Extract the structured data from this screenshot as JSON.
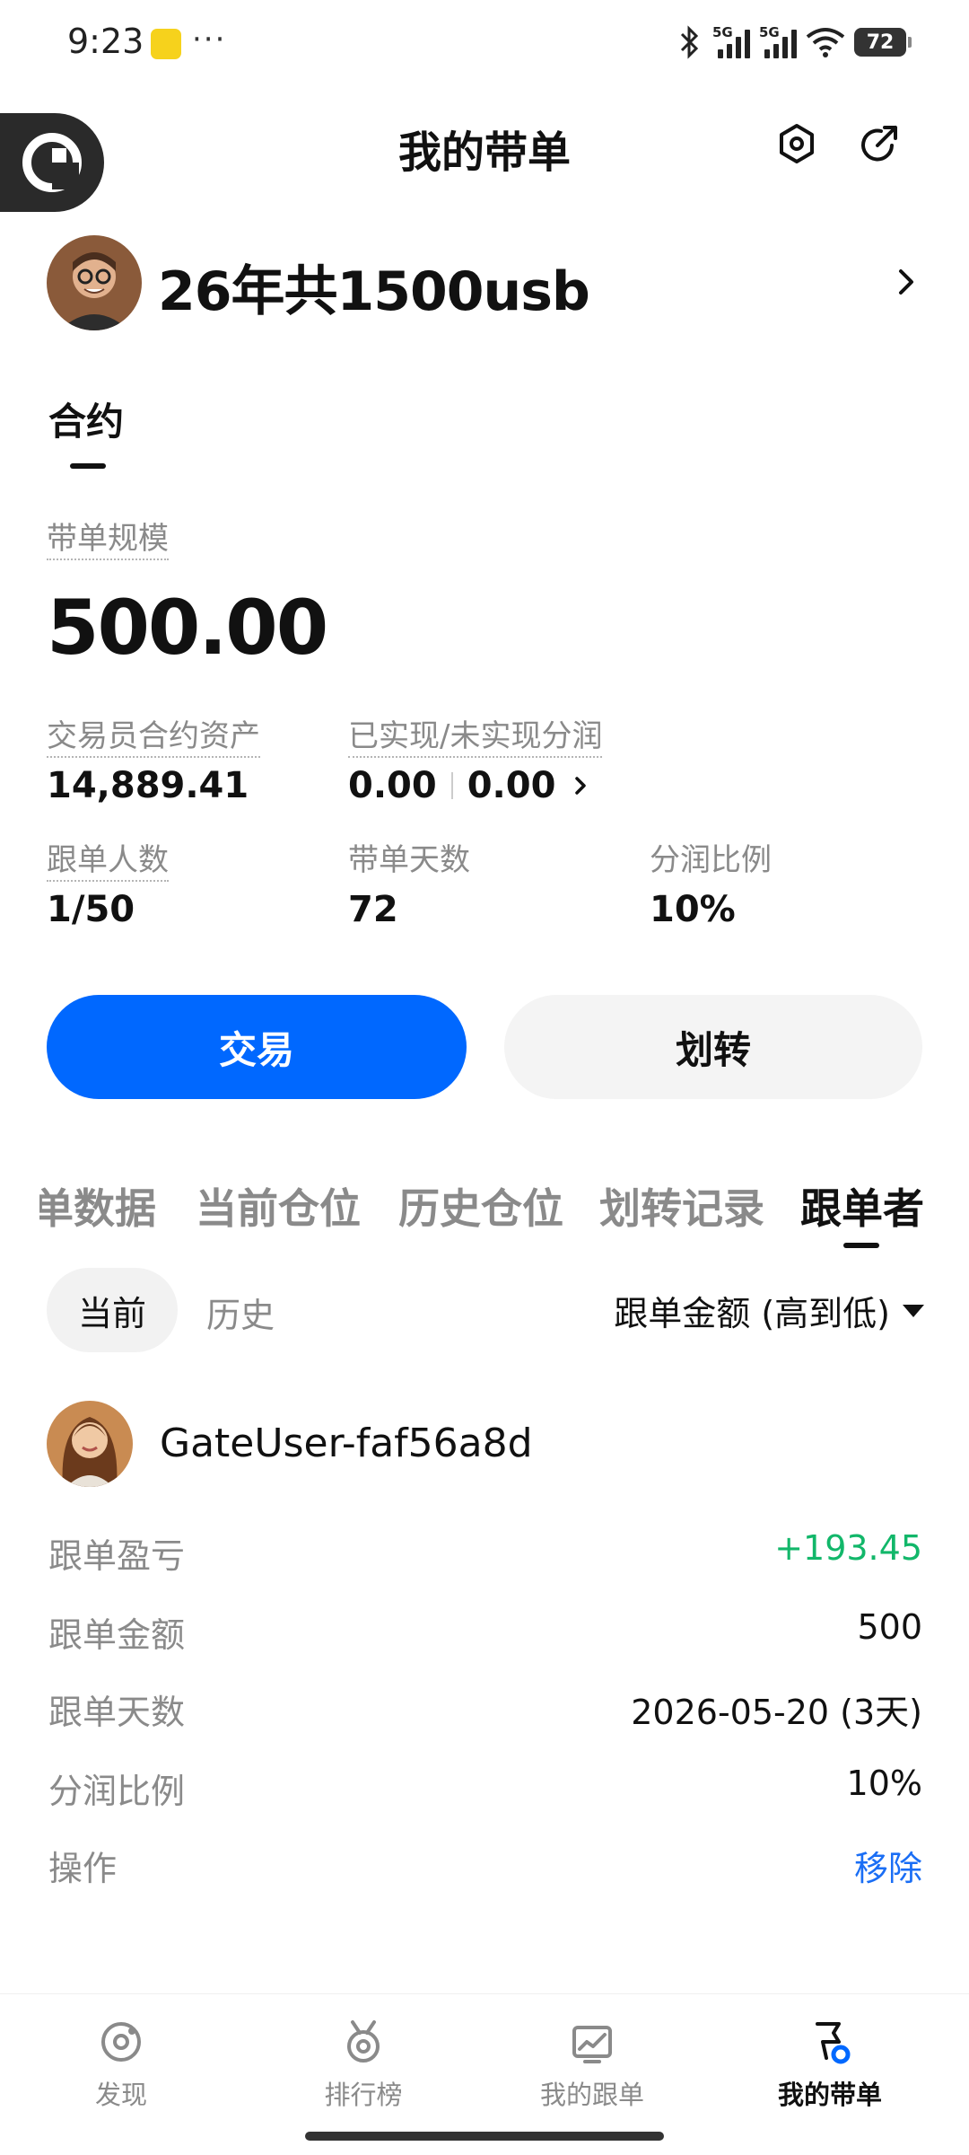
{
  "status_bar": {
    "time": "9:23",
    "dots": "···",
    "net_1": "5G",
    "net_2": "5G",
    "battery": "72"
  },
  "header": {
    "title": "我的带单"
  },
  "profile": {
    "name": "26年共1500usb"
  },
  "tabs": {
    "contract": "合约"
  },
  "summary": {
    "scale_label": "带单规模",
    "scale_value": "500.00",
    "trader_assets_label": "交易员合约资产",
    "trader_assets_value": "14,889.41",
    "profit_share_label": "已实现/未实现分润",
    "realized": "0.00",
    "unrealized": "0.00",
    "followers_label": "跟单人数",
    "followers_value": "1/50",
    "days_label": "带单天数",
    "days_value": "72",
    "ratio_label": "分润比例",
    "ratio_value": "10%"
  },
  "buttons": {
    "trade": "交易",
    "transfer": "划转"
  },
  "sub_tabs": [
    "单数据",
    "当前仓位",
    "历史仓位",
    "划转记录",
    "跟单者"
  ],
  "filter": {
    "current": "当前",
    "history": "历史",
    "sort": "跟单金额 (高到低)"
  },
  "follower": {
    "name": "GateUser-faf56a8d",
    "rows": [
      {
        "label": "跟单盈亏",
        "value": "+193.45"
      },
      {
        "label": "跟单金额",
        "value": "500"
      },
      {
        "label": "跟单天数",
        "value": "2026-05-20 (3天)"
      },
      {
        "label": "分润比例",
        "value": "10%"
      },
      {
        "label": "操作",
        "value": "移除"
      }
    ]
  },
  "bottom_nav": [
    {
      "label": "发现"
    },
    {
      "label": "排行榜"
    },
    {
      "label": "我的跟单"
    },
    {
      "label": "我的带单"
    }
  ],
  "colors": {
    "primary": "#0068ff",
    "profit": "#12b76a",
    "link": "#1a6ef5"
  }
}
